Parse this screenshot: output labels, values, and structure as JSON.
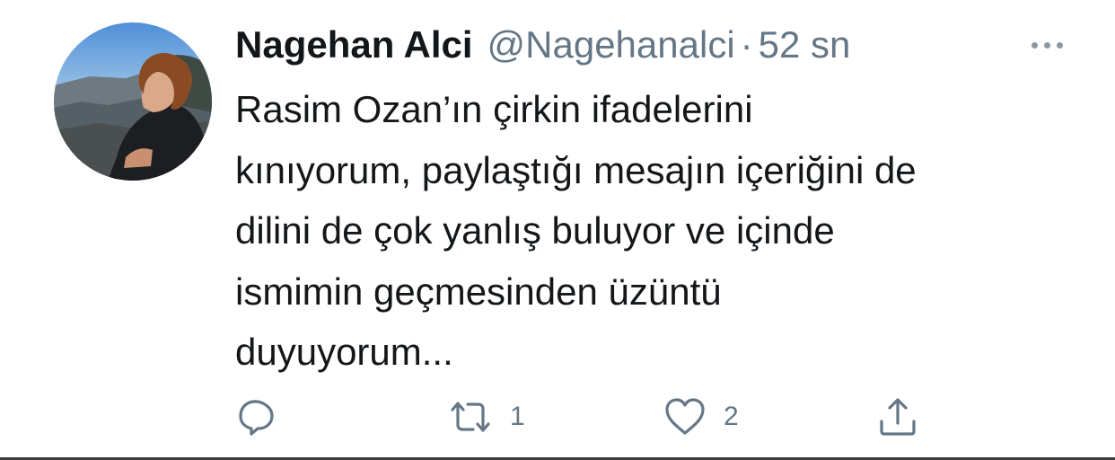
{
  "tweet": {
    "author_name": "Nagehan Alci",
    "handle": "@Nagehanalci",
    "separator": "·",
    "timestamp": "52 sn",
    "text_lines": [
      "Rasim Ozan’ın çirkin ifadelerini",
      "kınıyorum, paylaştığı mesajın içeriğini de",
      "dilini de çok yanlış buluyor ve içinde",
      "ismimin geçmesinden üzüntü",
      "duyuyorum..."
    ],
    "retweet_count": "1",
    "like_count": "2"
  },
  "icons": {
    "more": "more-horizontal-icon",
    "reply": "reply-bubble-icon",
    "retweet": "retweet-icon",
    "like": "heart-icon",
    "share": "share-icon"
  },
  "colors": {
    "text_primary": "#14171a",
    "text_secondary": "#657786",
    "icon": "#657786"
  }
}
